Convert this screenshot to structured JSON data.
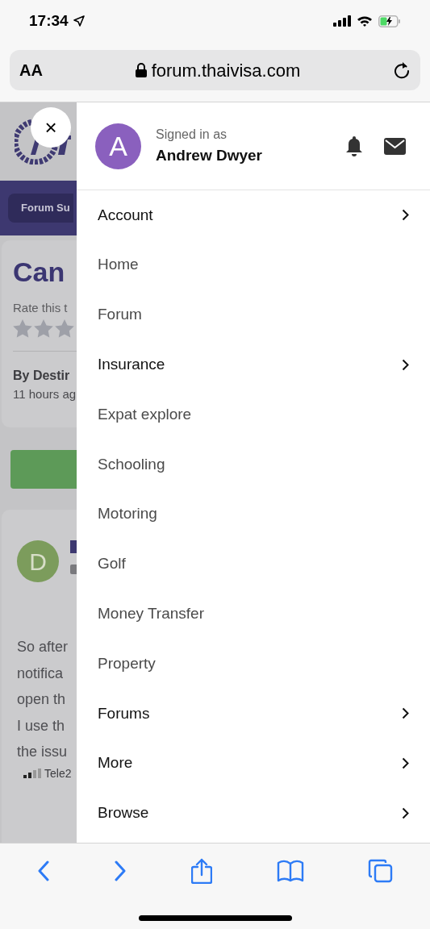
{
  "status_bar": {
    "time": "17:34"
  },
  "browser": {
    "text_size_button": "AA",
    "url": "forum.thaivisa.com"
  },
  "background_page": {
    "breadcrumb": "Forum Su",
    "title": "Can",
    "rate_label": "Rate this t",
    "author": "By Destir",
    "time": "11 hours ag",
    "post_avatar": "D",
    "post_lines": [
      "So after",
      "notifica",
      "open th",
      "I use th",
      "the issu"
    ],
    "signature": "Tele2"
  },
  "drawer": {
    "close": "×",
    "avatar": "A",
    "signed_in_label": "Signed in as",
    "user_name": "Andrew Dwyer",
    "items": [
      {
        "label": "Account",
        "has_submenu": true
      },
      {
        "label": "Home",
        "has_submenu": false
      },
      {
        "label": "Forum",
        "has_submenu": false
      },
      {
        "label": "Insurance",
        "has_submenu": true
      },
      {
        "label": "Expat explore",
        "has_submenu": false
      },
      {
        "label": "Schooling",
        "has_submenu": false
      },
      {
        "label": "Motoring",
        "has_submenu": false
      },
      {
        "label": "Golf",
        "has_submenu": false
      },
      {
        "label": "Money Transfer",
        "has_submenu": false
      },
      {
        "label": "Property",
        "has_submenu": false
      },
      {
        "label": "Forums",
        "has_submenu": true
      },
      {
        "label": "More",
        "has_submenu": true
      },
      {
        "label": "Browse",
        "has_submenu": true
      }
    ]
  }
}
